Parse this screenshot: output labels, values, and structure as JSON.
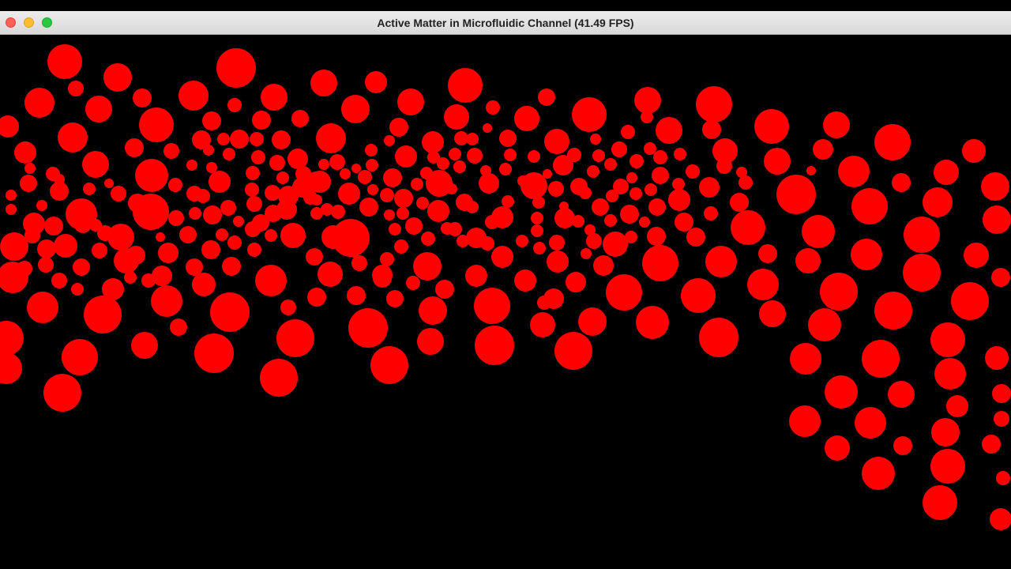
{
  "window": {
    "title": "Active Matter in Microfluidic Channel (41.49 FPS)"
  },
  "colors": {
    "background": "#000000",
    "particle": "#ff0000"
  }
}
